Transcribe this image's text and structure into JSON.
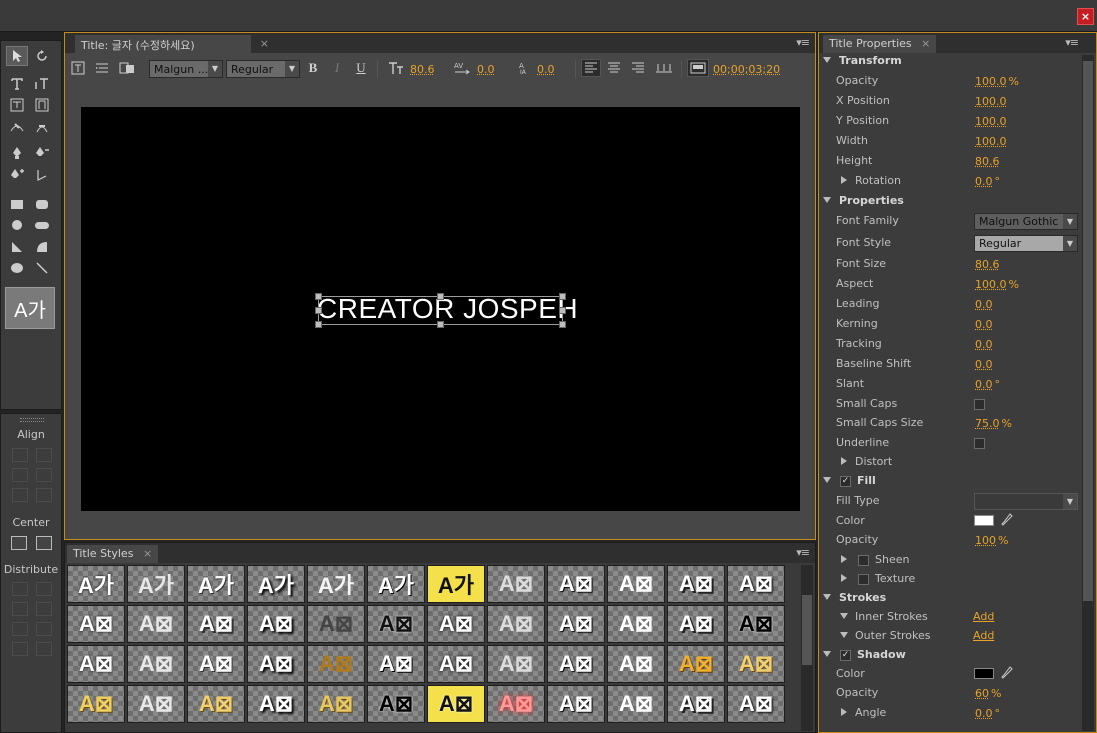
{
  "window": {
    "close_glyph": "×"
  },
  "tools": {
    "items": [
      "selection-tool",
      "rotation-tool",
      "type-tool",
      "vertical-type-tool",
      "area-type-tool",
      "vertical-area-type-tool",
      "path-type-tool",
      "vertical-path-type-tool",
      "pen-tool",
      "delete-anchor-point-tool",
      "add-anchor-point-tool",
      "convert-anchor-point-tool",
      "rectangle-tool",
      "rounded-corner-rectangle-tool",
      "ellipse-tool",
      "rounded-rectangle-tool",
      "wedge-tool",
      "arc-tool",
      "ellipse-tool-2",
      "line-tool"
    ],
    "preview_text": "A가"
  },
  "align_panel": {
    "align_label": "Align",
    "center_label": "Center",
    "distribute_label": "Distribute"
  },
  "title_panel": {
    "tab_label": "Title: 글자 (수정하세요)",
    "tab_close": "×",
    "menu_glyph": "▾≡",
    "font_family": "Malgun ...",
    "font_style": "Regular",
    "bold": "B",
    "italic": "I",
    "underline": "U",
    "font_size": "80.6",
    "kerning": "0.0",
    "leading": "0.0",
    "timecode": "00;00;03;20",
    "canvas_text": "CREATOR JOSPEH"
  },
  "styles_panel": {
    "tab_label": "Title Styles",
    "tab_close": "×",
    "menu_glyph": "▾≡",
    "rows": [
      [
        "A가",
        "A가",
        "A가",
        "A가",
        "A가",
        "A가",
        "A가",
        "A⊠",
        "A⊠",
        "A⊠",
        "A⊠",
        "A⊠"
      ],
      [
        "A⊠",
        "A⊠",
        "A⊠",
        "A⊠",
        "A⊠",
        "A⊠",
        "A⊠",
        "A⊠",
        "A⊠",
        "A⊠",
        "A⊠",
        "A⊠"
      ],
      [
        "A⊠",
        "A⊠",
        "A⊠",
        "A⊠",
        "A⊠",
        "A⊠",
        "A⊠",
        "A⊠",
        "A⊠",
        "A⊠",
        "A⊠",
        "A⊠"
      ],
      [
        "A⊠",
        "A⊠",
        "A⊠",
        "A⊠",
        "A⊠",
        "A⊠",
        "A⊠",
        "A⊠",
        "A⊠",
        "A⊠",
        "A⊠",
        "A⊠"
      ]
    ]
  },
  "props_panel": {
    "tab_label": "Title Properties",
    "tab_close": "×",
    "menu_glyph": "▾≡",
    "transform": {
      "heading": "Transform",
      "opacity_label": "Opacity",
      "opacity": "100.0",
      "opacity_unit": "%",
      "x_label": "X Position",
      "x": "100.0",
      "y_label": "Y Position",
      "y": "100.0",
      "width_label": "Width",
      "width": "100.0",
      "height_label": "Height",
      "height": "80.6",
      "rotation_label": "Rotation",
      "rotation": "0.0",
      "rotation_unit": "°"
    },
    "properties": {
      "heading": "Properties",
      "font_family_label": "Font Family",
      "font_family": "Malgun Gothic",
      "font_style_label": "Font Style",
      "font_style": "Regular",
      "font_size_label": "Font Size",
      "font_size": "80.6",
      "aspect_label": "Aspect",
      "aspect": "100.0",
      "aspect_unit": "%",
      "leading_label": "Leading",
      "leading": "0.0",
      "kerning_label": "Kerning",
      "kerning": "0.0",
      "tracking_label": "Tracking",
      "tracking": "0.0",
      "baseline_label": "Baseline Shift",
      "baseline": "0.0",
      "slant_label": "Slant",
      "slant": "0.0",
      "slant_unit": "°",
      "small_caps_label": "Small Caps",
      "small_caps": false,
      "small_caps_size_label": "Small Caps Size",
      "small_caps_size": "75.0",
      "small_caps_size_unit": "%",
      "underline_label": "Underline",
      "underline": false,
      "distort_label": "Distort"
    },
    "fill": {
      "heading": "Fill",
      "enabled": true,
      "fill_type_label": "Fill Type",
      "fill_type": "",
      "color_label": "Color",
      "color": "#ffffff",
      "opacity_label": "Opacity",
      "opacity": "100",
      "opacity_unit": "%",
      "sheen_label": "Sheen",
      "texture_label": "Texture"
    },
    "strokes": {
      "heading": "Strokes",
      "inner_label": "Inner Strokes",
      "inner_action": "Add",
      "outer_label": "Outer Strokes",
      "outer_action": "Add"
    },
    "shadow": {
      "heading": "Shadow",
      "enabled": true,
      "color_label": "Color",
      "color": "#000000",
      "opacity_label": "Opacity",
      "opacity": "60",
      "opacity_unit": "%",
      "angle_label": "Angle",
      "angle": "0.0",
      "angle_unit": "°"
    }
  },
  "colors": {
    "accent": "#e6a22a",
    "panel_border_active": "#c08c1a",
    "close_button": "#c61d23"
  }
}
